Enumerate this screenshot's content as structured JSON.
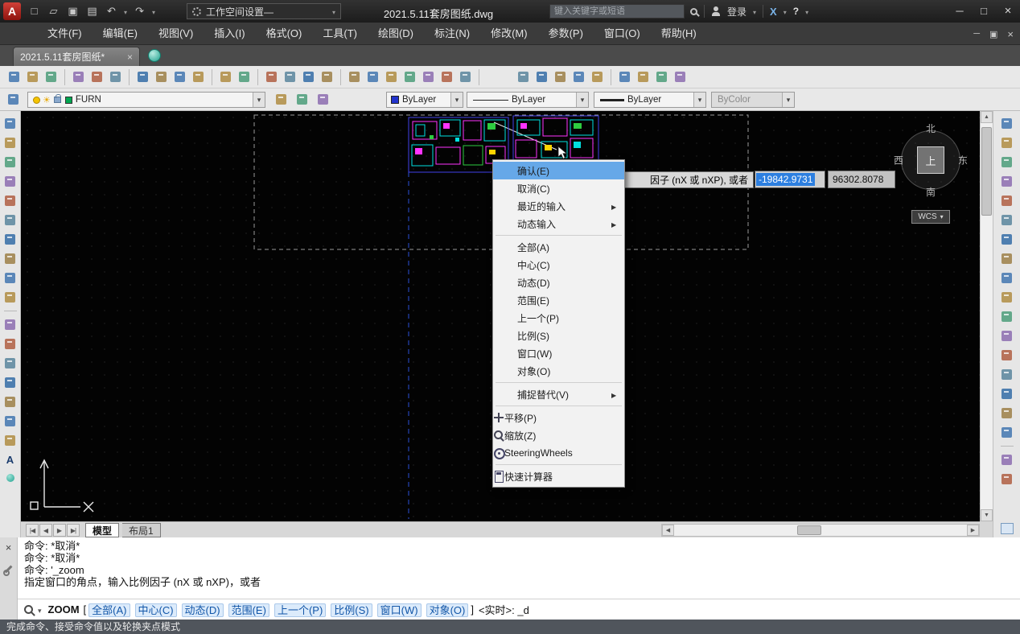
{
  "colors": {
    "menu_highlight": "#66a8e8",
    "selection_blue": "#2d7fe0",
    "layer_swatch_green": "#00a651",
    "color_swatch_blue": "#2233cc",
    "cluster_outline_blue": "#4040e8",
    "furniture_magenta": "#ff33ff",
    "furniture_cyan": "#00e0e0",
    "furniture_green": "#2ecc40"
  },
  "titlebar": {
    "workspace_label": "工作空间设置—",
    "doc_title": "2021.5.11套房图纸.dwg",
    "search_placeholder": "键入关键字或短语",
    "login_label": "登录"
  },
  "menubar": {
    "items": [
      "文件(F)",
      "编辑(E)",
      "视图(V)",
      "插入(I)",
      "格式(O)",
      "工具(T)",
      "绘图(D)",
      "标注(N)",
      "修改(M)",
      "参数(P)",
      "窗口(O)",
      "帮助(H)"
    ]
  },
  "doctabs": {
    "active_tab": "2021.5.11套房图纸*"
  },
  "toolbars": {
    "row1_groups": [
      [
        "new",
        "open",
        "save"
      ],
      [
        "plot",
        "preview",
        "publish"
      ],
      [
        "cut",
        "copy-clip",
        "paste",
        "match-properties"
      ],
      [
        "undo",
        "redo"
      ],
      [
        "pan",
        "zoom-realtime",
        "zoom-window",
        "zoom-previous"
      ],
      [
        "properties",
        "design-center",
        "tool-palettes",
        "sheet-set-manager",
        "markup-set-manager",
        "quick-calc",
        "help"
      ],
      "SPACE",
      [
        "snap-to-endpoint",
        "snap-to-midpoint",
        "snap-to-center",
        "snap-to-intersection",
        "snap-settings"
      ],
      [
        "zoom-window-2",
        "zoom-in",
        "zoom-out",
        "zoom-extents"
      ]
    ],
    "left_groups": [
      [
        "line",
        "construction-line",
        "polyline",
        "polygon",
        "rectangle",
        "arc",
        "circle",
        "revision-cloud",
        "spline",
        "ellipse"
      ],
      [
        "insert-block",
        "make-block",
        "point",
        "hatch",
        "gradient",
        "region",
        "table",
        "multiline-text"
      ]
    ],
    "right_groups": [
      [
        "erase",
        "copy-object",
        "mirror",
        "offset",
        "array",
        "move",
        "rotate",
        "scale",
        "stretch",
        "trim",
        "extend",
        "break-at-point",
        "break",
        "join",
        "chamfer",
        "fillet",
        "explode"
      ],
      [
        "draw-order-front",
        "draw-order-back"
      ]
    ]
  },
  "layer_toolbar": {
    "layer_name": "FURN",
    "color": "ByLayer",
    "linetype": "ByLayer",
    "lineweight": "ByLayer",
    "plot_style": "ByColor"
  },
  "viewcube": {
    "north": "北",
    "west": "西",
    "east": "东",
    "south": "南",
    "top": "上",
    "wcs_label": "WCS"
  },
  "context_menu": {
    "items": [
      {
        "label": "确认(E)",
        "highlighted": true
      },
      {
        "label": "取消(C)"
      },
      {
        "label": "最近的输入",
        "submenu": true
      },
      {
        "label": "动态输入",
        "submenu": true,
        "sep_after": true
      },
      {
        "label": "全部(A)"
      },
      {
        "label": "中心(C)"
      },
      {
        "label": "动态(D)"
      },
      {
        "label": "范围(E)"
      },
      {
        "label": "上一个(P)"
      },
      {
        "label": "比例(S)"
      },
      {
        "label": "窗口(W)"
      },
      {
        "label": "对象(O)",
        "sep_after": true
      },
      {
        "label": "捕捉替代(V)",
        "submenu": true,
        "sep_after": true
      },
      {
        "label": "平移(P)",
        "icon": "pan"
      },
      {
        "label": "缩放(Z)",
        "icon": "zoom"
      },
      {
        "label": "SteeringWheels",
        "icon": "wheel",
        "sep_after": true
      },
      {
        "label": "快速计算器",
        "icon": "calc"
      }
    ]
  },
  "dynamic_input": {
    "prompt": "因子 (nX 或 nXP), 或者",
    "value1": "-19842.9731",
    "value2": "96302.8078"
  },
  "layout_tabs": {
    "items": [
      "模型",
      "布局1"
    ],
    "active_index": 0
  },
  "command": {
    "history": [
      "命令: *取消*",
      "命令: *取消*",
      "命令: '_zoom",
      "指定窗口的角点，输入比例因子 (nX 或 nXP)，或者"
    ],
    "prompt": {
      "command": "ZOOM",
      "bracket_open": "[",
      "options": [
        "全部(A)",
        "中心(C)",
        "动态(D)",
        "范围(E)",
        "上一个(P)",
        "比例(S)",
        "窗口(W)",
        "对象(O)"
      ],
      "bracket_close": "]",
      "suffix": "<实时>: _d"
    }
  },
  "statusbar": {
    "message": "完成命令、接受命令值以及轮换夹点模式"
  }
}
